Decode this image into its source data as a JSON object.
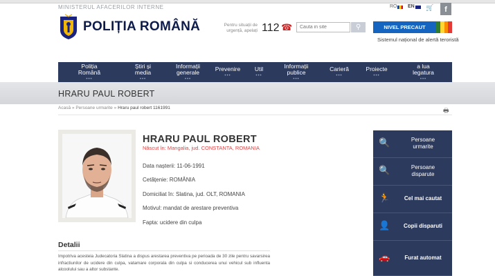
{
  "topbar": {
    "ministry": "MINISTERUL AFACERILOR INTERNE",
    "lang_ro": "RO",
    "lang_en": "EN",
    "facebook": "f"
  },
  "header": {
    "brand": "POLIȚIA ROMÂNĂ",
    "urgent_text": "Pentru situații de urgență, apelați",
    "urgent_number": "112",
    "search_placeholder": "Cauta in site",
    "alert_label": "NIVEL PRECAUT",
    "alert_sub": "Sistemul național de alertă teroristă",
    "alert_colors": [
      "#2e7d32",
      "#fdd835",
      "#fb8c00",
      "#e53935"
    ]
  },
  "nav": {
    "items": [
      {
        "l1": "Poliția",
        "l2": "Română"
      },
      {
        "l1": "Știri și",
        "l2": "media"
      },
      {
        "l1": "Informații",
        "l2": "generale"
      },
      {
        "l1": "Prevenire",
        "l2": ""
      },
      {
        "l1": "Util",
        "l2": ""
      },
      {
        "l1": "Informații",
        "l2": "publice"
      },
      {
        "l1": "Carieră",
        "l2": ""
      },
      {
        "l1": "Proiecte",
        "l2": ""
      },
      {
        "l1": "a lua",
        "l2": "legatura"
      }
    ],
    "dots": "•••"
  },
  "page": {
    "title": "HRARU PAUL ROBERT"
  },
  "breadcrumb": {
    "home": "Acasă",
    "sep": "»",
    "section": "Persoane urmarite",
    "current": "Hraru paul robert 1161991"
  },
  "person": {
    "name": "HRARU PAUL ROBERT",
    "born": "Născut în: Mangalia, jud. CONSTANTA, ROMANIA",
    "birthdate": "Data nașterii: 11-06-1991",
    "citizenship": "Cetățenie: ROMÂNIA",
    "residence": "Domiciliat în: Slatina, jud. OLT, ROMANIA",
    "reason": "Motivul: mandat de arestare preventiva",
    "offence": "Fapta: ucidere din culpa"
  },
  "details": {
    "title": "Detalii",
    "text": "Impotriva acesteia Judecatoria Slatina a dispus arestarea preventiva pe perioada de 30 zile pentru savarsirea infractiunilor de ucidere din culpa, vatamare corporala din culpa si conducerea unui vehicul sub influenta alcoolului sau a altor substante."
  },
  "sidebar": {
    "items": [
      {
        "l1": "Persoane",
        "l2": "urmarite",
        "icon": "search-person-icon"
      },
      {
        "l1": "Persoane",
        "l2": "disparute",
        "icon": "search-person-icon"
      },
      {
        "l1": "Cel mai cautat",
        "l2": "",
        "icon": "running-person-icon"
      },
      {
        "l1": "Copii disparuti",
        "l2": "",
        "icon": "child-icon"
      },
      {
        "l1": "Furat automat",
        "l2": "",
        "icon": "car-icon"
      }
    ]
  }
}
